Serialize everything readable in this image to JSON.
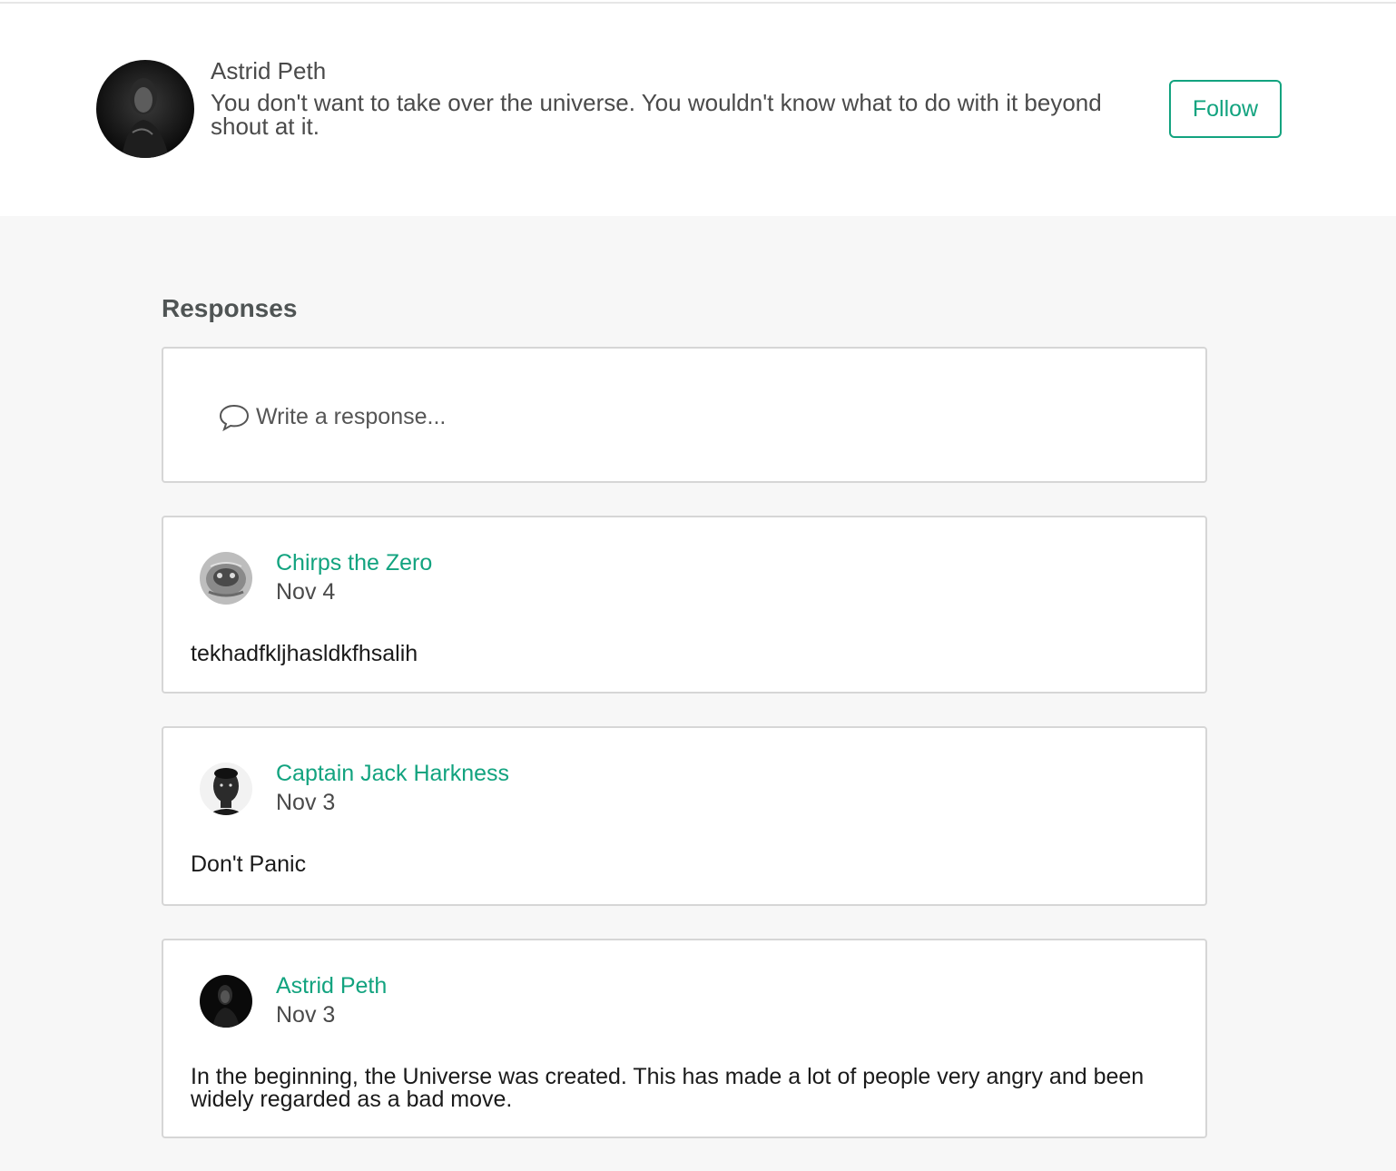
{
  "author": {
    "name": "Astrid Peth",
    "bio": "You don't want to take over the universe. You wouldn't know what to do with it beyond shout at it.",
    "follow_label": "Follow"
  },
  "responses_section": {
    "title": "Responses",
    "compose_placeholder": "Write a response..."
  },
  "responses": [
    {
      "name": "Chirps the Zero",
      "date": "Nov 4",
      "body": "tekhadfkljhasldkfhsalih"
    },
    {
      "name": "Captain Jack Harkness",
      "date": "Nov 3",
      "body": "Don't Panic"
    },
    {
      "name": "Astrid Peth",
      "date": "Nov 3",
      "body": "In the beginning, the Universe was created. This has made a lot of people very angry and been widely regarded as a bad move."
    }
  ],
  "colors": {
    "accent": "#12a37f",
    "background": "#f7f7f7",
    "card_border": "#d6d6d6"
  },
  "icons": {
    "compose": "speech-bubble-icon"
  }
}
